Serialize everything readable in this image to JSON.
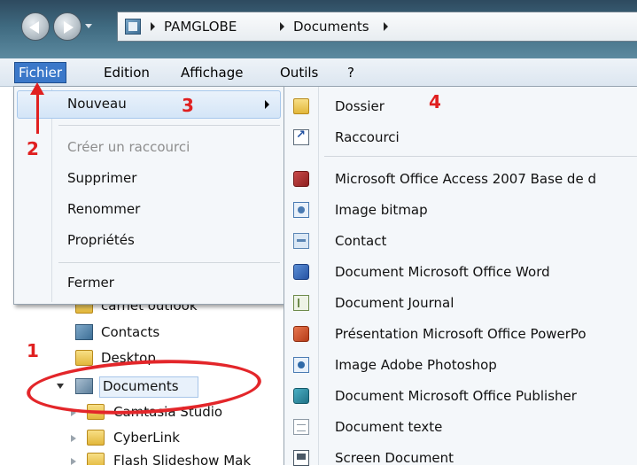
{
  "address": {
    "crumbs": [
      "PAMGLOBE",
      "Documents"
    ]
  },
  "menubar": {
    "items": [
      "Fichier",
      "Edition",
      "Affichage",
      "Outils",
      "?"
    ],
    "active": "Fichier"
  },
  "file_menu": {
    "items": [
      {
        "label": "Nouveau",
        "enabled": true,
        "has_submenu": true
      },
      {
        "label": "Créer un raccourci",
        "enabled": false
      },
      {
        "label": "Supprimer",
        "enabled": true
      },
      {
        "label": "Renommer",
        "enabled": true
      },
      {
        "label": "Propriétés",
        "enabled": true
      },
      {
        "label": "Fermer",
        "enabled": true
      }
    ]
  },
  "new_submenu": {
    "items": [
      {
        "label": "Dossier",
        "icon": "folder-icon"
      },
      {
        "label": "Raccourci",
        "icon": "shortcut-icon"
      },
      {
        "label": "Microsoft Office Access 2007 Base de d",
        "icon": "access-icon"
      },
      {
        "label": "Image bitmap",
        "icon": "bitmap-icon"
      },
      {
        "label": "Contact",
        "icon": "contact-icon"
      },
      {
        "label": "Document Microsoft Office Word",
        "icon": "word-icon"
      },
      {
        "label": "Document Journal",
        "icon": "journal-icon"
      },
      {
        "label": "Présentation Microsoft Office PowerPo",
        "icon": "powerpoint-icon"
      },
      {
        "label": "Image Adobe Photoshop",
        "icon": "photoshop-icon"
      },
      {
        "label": "Document Microsoft Office Publisher",
        "icon": "publisher-icon"
      },
      {
        "label": "Document texte",
        "icon": "text-document-icon"
      },
      {
        "label": "Screen Document",
        "icon": "screen-document-icon"
      }
    ]
  },
  "tree": {
    "items": [
      {
        "label": "carnet outlook"
      },
      {
        "label": "Contacts"
      },
      {
        "label": "Desktop"
      },
      {
        "label": "Documents",
        "selected": true,
        "expanded": true
      },
      {
        "label": "Camtasia Studio"
      },
      {
        "label": "CyberLink"
      },
      {
        "label": "Flash Slideshow Mak"
      }
    ]
  },
  "annotations": {
    "step1": "1",
    "step2": "2",
    "step3": "3",
    "step4": "4",
    "color": "#e02020"
  }
}
